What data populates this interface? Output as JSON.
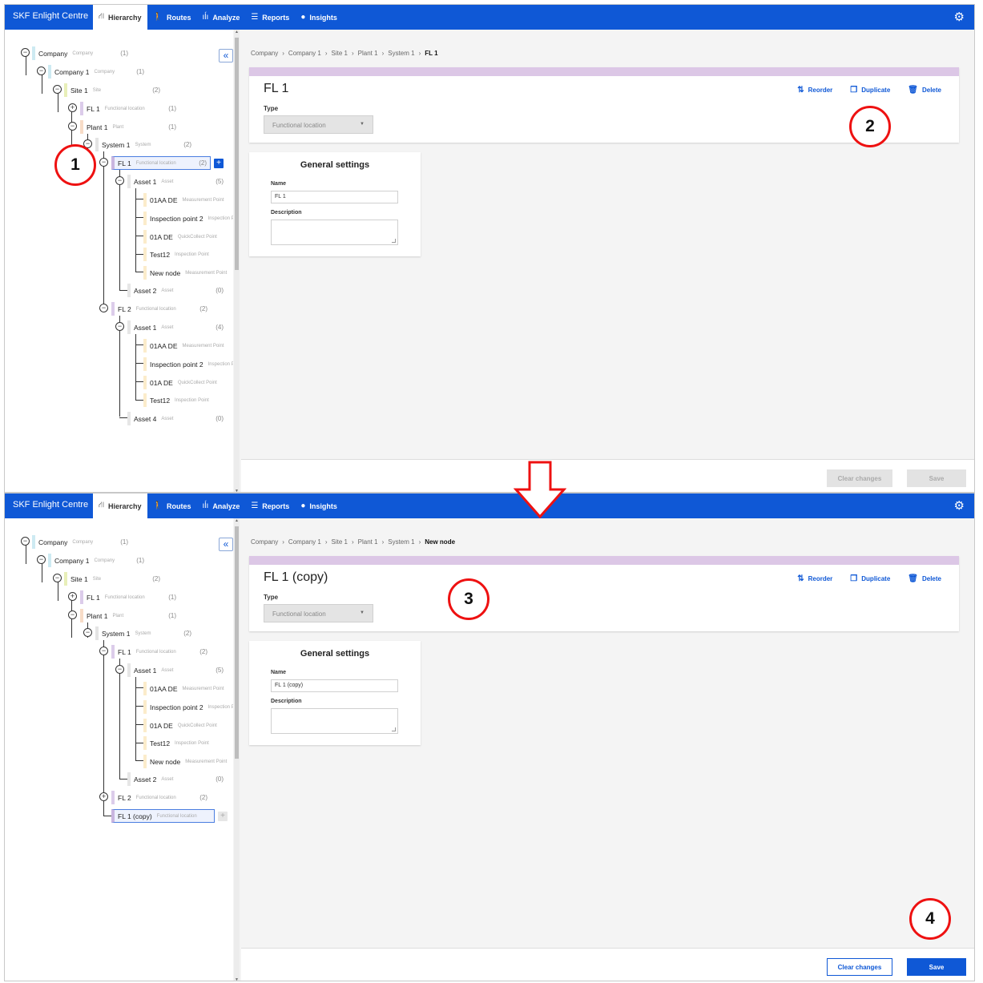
{
  "app": {
    "brand": "SKF Enlight Centre",
    "tabs": [
      {
        "label": "Hierarchy",
        "icon": "hierarchy-icon"
      },
      {
        "label": "Routes",
        "icon": "route-icon"
      },
      {
        "label": "Analyze",
        "icon": "analyze-icon"
      },
      {
        "label": "Reports",
        "icon": "reports-icon"
      },
      {
        "label": "Insights",
        "icon": "bulb-icon"
      }
    ],
    "collapse_label": "«"
  },
  "tree": {
    "company": {
      "name": "Company",
      "type": "Company",
      "count": "(1)"
    },
    "company1": {
      "name": "Company 1",
      "type": "Company",
      "count": "(1)"
    },
    "site1": {
      "name": "Site 1",
      "type": "Site",
      "count": "(2)"
    },
    "fl1_site": {
      "name": "FL 1",
      "type": "Functional location",
      "count": "(1)"
    },
    "plant1": {
      "name": "Plant 1",
      "type": "Plant",
      "count": "(1)"
    },
    "system1": {
      "name": "System 1",
      "type": "System",
      "count": "(2)"
    },
    "fl1": {
      "name": "FL 1",
      "type": "Functional location",
      "count": "(2)"
    },
    "asset1": {
      "name": "Asset 1",
      "type": "Asset",
      "count": "(5)"
    },
    "mp_01aa": {
      "name": "01AA DE",
      "type": "Measurement Point"
    },
    "ip2": {
      "name": "Inspection point 2",
      "type": "Inspection Point"
    },
    "qc_01a": {
      "name": "01A DE",
      "type": "QuickCollect Point"
    },
    "test12": {
      "name": "Test12",
      "type": "Inspection Point"
    },
    "newnode": {
      "name": "New node",
      "type": "Measurement Point"
    },
    "asset2": {
      "name": "Asset 2",
      "type": "Asset",
      "count": "(0)"
    },
    "fl2": {
      "name": "FL 2",
      "type": "Functional location",
      "count": "(2)"
    },
    "fl2_asset1": {
      "name": "Asset 1",
      "type": "Asset",
      "count": "(4)"
    },
    "asset4": {
      "name": "Asset 4",
      "type": "Asset",
      "count": "(0)"
    },
    "fl1copy": {
      "name": "FL 1 (copy)",
      "type": "Functional location"
    }
  },
  "screen1": {
    "breadcrumb": [
      "Company",
      "Company 1",
      "Site 1",
      "Plant 1",
      "System 1"
    ],
    "breadcrumb_current": "FL 1",
    "title": "FL 1",
    "name_value": "FL 1"
  },
  "screen2": {
    "breadcrumb": [
      "Company",
      "Company 1",
      "Site 1",
      "Plant 1",
      "System 1"
    ],
    "breadcrumb_current": "New node",
    "title": "FL 1 (copy)",
    "name_value": "FL 1 (copy)"
  },
  "details": {
    "type_label": "Type",
    "type_value": "Functional location",
    "reorder": "Reorder",
    "duplicate": "Duplicate",
    "delete": "Delete",
    "settings_title": "General settings",
    "name_label": "Name",
    "description_label": "Description"
  },
  "footer": {
    "clear_label": "Clear changes",
    "save_label": "Save"
  },
  "annotations": {
    "step1": "1",
    "step2": "2",
    "step3": "3",
    "step4": "4"
  },
  "colors": {
    "brand_blue": "#0f58d6",
    "annotation_red": "#e11111",
    "fl_stripe": "#dcc7e6"
  }
}
